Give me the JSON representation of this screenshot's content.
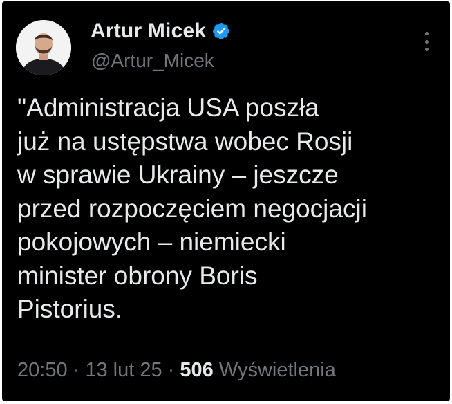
{
  "tweet": {
    "author": {
      "name": "Artur Micek",
      "handle": "@Artur_Micek",
      "verified_color": "#1d9bf0"
    },
    "text": "\"Administracja USA poszła\njuż na ustępstwa wobec Rosji\nw sprawie Ukrainy – jeszcze\nprzed rozpoczęciem negocjacji\npokojowych – niemiecki\nminister obrony Boris\nPistorius.",
    "time": "20:50",
    "separator": " · ",
    "date": "13 lut 25",
    "views_count": "506",
    "views_label": "Wyświetlenia"
  }
}
